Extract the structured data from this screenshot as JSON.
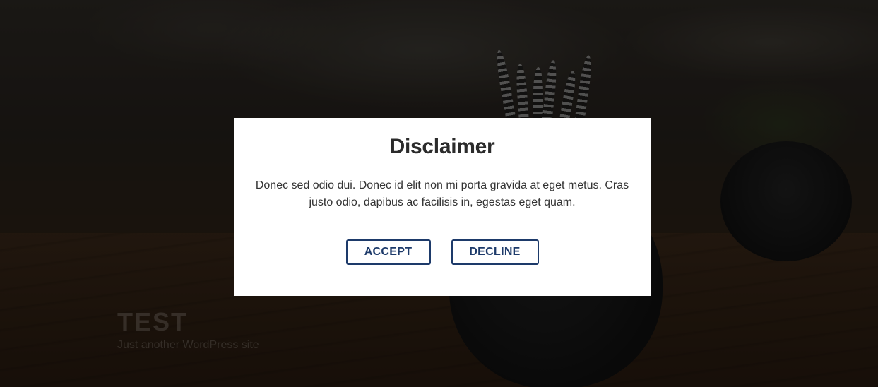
{
  "site": {
    "title": "TEST",
    "tagline": "Just another WordPress site"
  },
  "disclaimer": {
    "title": "Disclaimer",
    "body": "Donec sed odio dui. Donec id elit non mi porta gravida at eget metus. Cras justo odio, dapibus ac facilisis in, egestas eget quam.",
    "accept_label": "ACCEPT",
    "decline_label": "DECLINE"
  },
  "colors": {
    "button_accent": "#1d3a6a",
    "overlay": "rgba(0,0,0,0.55)",
    "modal_background": "#ffffff"
  }
}
